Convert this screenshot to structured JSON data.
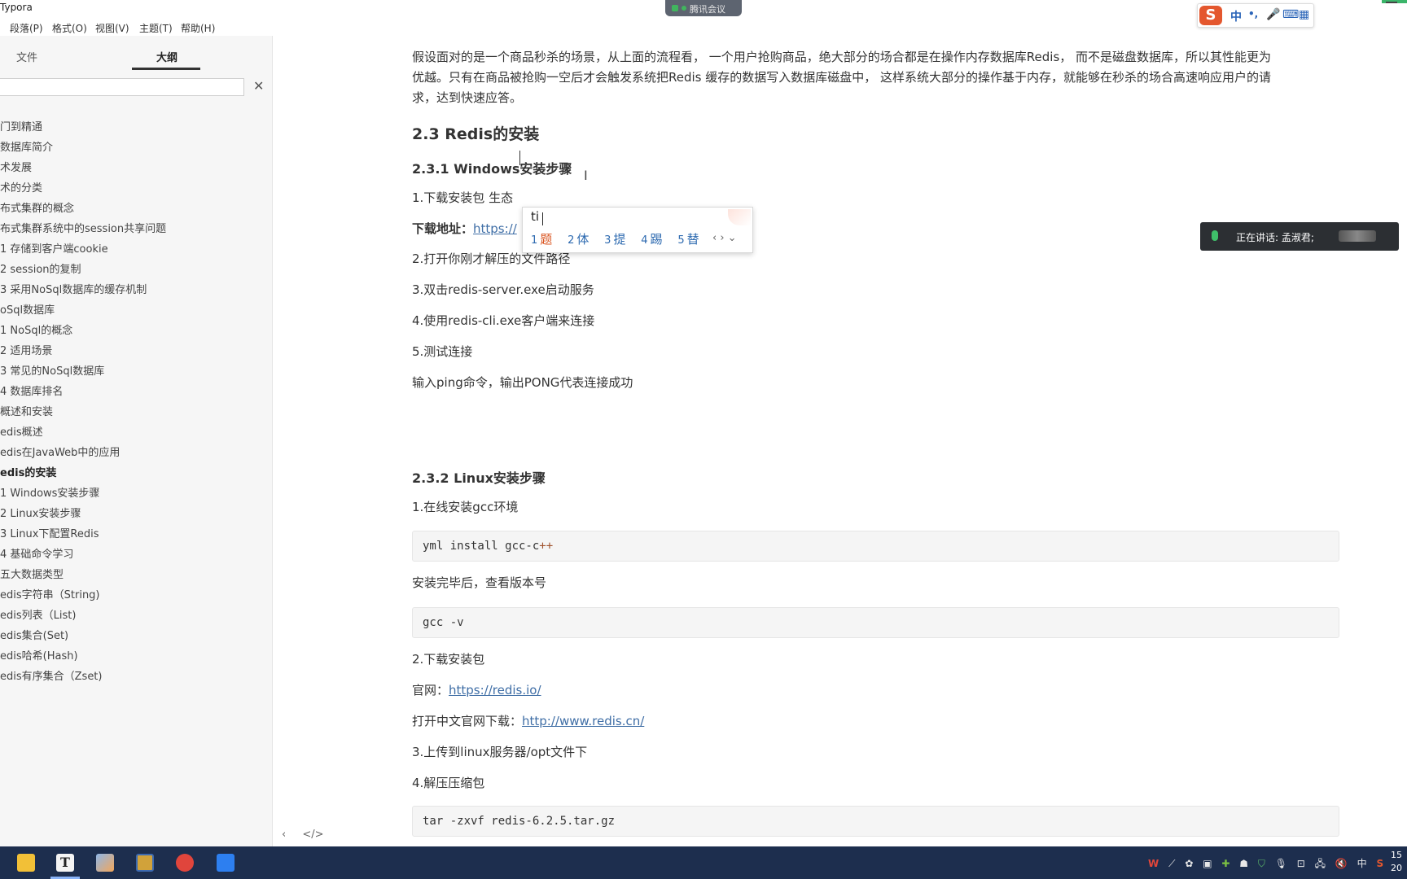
{
  "window": {
    "title": "Typora"
  },
  "menu": [
    "段落(P)",
    "格式(O)",
    "视图(V)",
    "主题(T)",
    "帮助(H)"
  ],
  "meeting": {
    "label": "腾讯会议"
  },
  "ime_bar": {
    "logo": "S",
    "items": [
      "中",
      "•,",
      "mic",
      "kbd",
      "grid"
    ]
  },
  "sidebar": {
    "tab_files": "文件",
    "tab_outline": "大纲",
    "search_placeholder": "",
    "close_glyph": "✕",
    "outline": [
      "门到精通",
      "数据库简介",
      "术发展",
      "术的分类",
      "布式集群的概念",
      "布式集群系统中的session共享问题",
      "1 存储到客户端cookie",
      "2 session的复制",
      "3 采用NoSql数据库的缓存机制",
      "oSql数据库",
      "1 NoSql的概念",
      "2 适用场景",
      "3 常见的NoSql数据库",
      "4 数据库排名",
      "概述和安装",
      "edis概述",
      "edis在JavaWeb中的应用",
      "edis的安装",
      "1 Windows安装步骤",
      "2 Linux安装步骤",
      "3 Linux下配置Redis",
      "4 基础命令学习",
      "五大数据类型",
      "edis字符串（String)",
      "edis列表（List)",
      "edis集合(Set)",
      "edis哈希(Hash)",
      "edis有序集合（Zset)"
    ],
    "active_index": 17,
    "footer": [
      "‹",
      "</>"
    ]
  },
  "content": {
    "intro_line1": "假设面对的是一个商品秒杀的场景，从上面的流程看， 一个用户抢购商品，绝大部分的场合都是在操作内存数据库Redis， 而不是磁盘数据库，所以其性能更为",
    "intro_line2": "优越。只有在商品被抢购一空后才会触发系统把Redis 缓存的数据写入数据库磁盘中， 这样系统大部分的操作基于内存，就能够在秒杀的场合高速响应用户的请",
    "intro_line3": "求，达到快速应答。",
    "h2_install": "2.3 Redis的安装",
    "h3_windows": "2.3.1 Windows安装步骤",
    "win_step1": "1.下载安装包  生态",
    "download_label": "下载地址：",
    "download_link": "https://",
    "win_step2": "2.打开你刚才解压的文件路径",
    "win_step3": "3.双击redis-server.exe启动服务",
    "win_step4": "4.使用redis-cli.exe客户端来连接",
    "win_step5": "5.测试连接",
    "win_ping": "输入ping命令，输出PONG代表连接成功",
    "h3_linux": "2.3.2 Linux安装步骤",
    "linux_step1": "1.在线安装gcc环境",
    "code1_main": "yml install gcc-c",
    "code1_op": "++",
    "linux_after": "安装完毕后，查看版本号",
    "code2": "gcc -v",
    "linux_step2": "2.下载安装包",
    "site_label": "官网：",
    "site_link": "https://redis.io/",
    "cn_label": "打开中文官网下载：",
    "cn_link": "http://www.redis.cn/",
    "linux_step3": "3.上传到linux服务器/opt文件下",
    "linux_step4": "4.解压压缩包",
    "code3": "tar -zxvf  redis-6.2.5.tar.gz"
  },
  "ime_popup": {
    "input": "ti",
    "candidates": [
      {
        "num": "1",
        "char": "题"
      },
      {
        "num": "2",
        "char": "体"
      },
      {
        "num": "3",
        "char": "提"
      },
      {
        "num": "4",
        "char": "踢"
      },
      {
        "num": "5",
        "char": "替"
      }
    ],
    "nav": "‹ › ⌄"
  },
  "speaking": {
    "label": "正在讲话: 孟淑君;"
  },
  "taskbar": {
    "apps": [
      "file-explorer",
      "typora",
      "paint",
      "sublime",
      "record",
      "tencent-meeting"
    ],
    "tray": [
      "W",
      "⟋",
      "✿",
      "▣",
      "✚",
      "☗",
      "⛉",
      "🎙",
      "⊡",
      "🖧",
      "🔇",
      "中",
      "S"
    ],
    "clock_top": "15",
    "clock_bottom": "20"
  },
  "colors": {
    "link": "#3f6ea6",
    "taskbar": "#1d2e4e",
    "accent_green": "#3bb56a",
    "ime_orange": "#d9531e"
  }
}
